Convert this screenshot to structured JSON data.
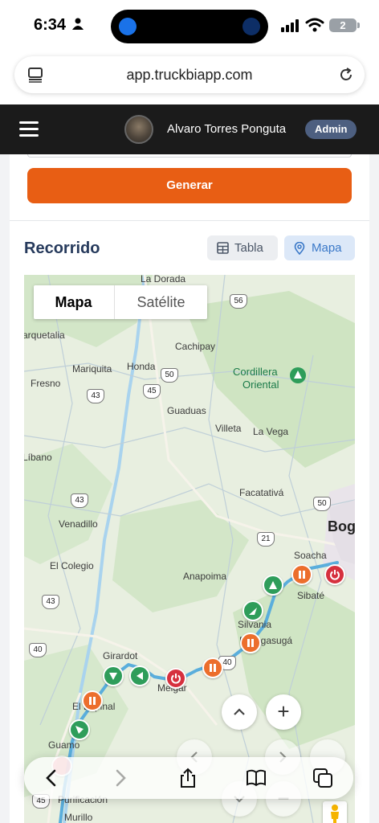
{
  "status_bar": {
    "time": "6:34",
    "battery": "2"
  },
  "browser": {
    "url": "app.truckbiapp.com"
  },
  "header": {
    "user_name": "Alvaro Torres Ponguta",
    "role": "Admin"
  },
  "actions": {
    "generate_label": "Generar"
  },
  "section": {
    "title": "Recorrido",
    "table_button": "Tabla",
    "map_button": "Mapa",
    "selected_view": "Mapa"
  },
  "map": {
    "type_map": "Mapa",
    "type_satellite": "Satélite",
    "zoom_in": "+",
    "zoom_out": "−",
    "labels": {
      "la_dorada": "La Dorada",
      "marquetalia": "arquetalia",
      "cachipay": "Cachipay",
      "mariquita": "Mariquita",
      "honda": "Honda",
      "fresno": "Fresno",
      "cordillera": "Cordillera",
      "oriental": "Oriental",
      "guaduas": "Guaduas",
      "villeta": "Villeta",
      "la_vega": "La Vega",
      "libano": "Líbano",
      "facatativa": "Facatativá",
      "venadillo": "Venadillo",
      "bogota": "Bog",
      "el_colegio": "El Colegio",
      "anapoima": "Anapoima",
      "soacha": "Soacha",
      "sibate": "Sibaté",
      "silvania": "Silvania",
      "fusagasuga": "Fusagasugá",
      "girardot": "Girardot",
      "melgar": "Melgar",
      "el_espinal": "El Espinal",
      "guamo": "Guamo",
      "purificacion": "Purificación",
      "murillo": "Murillo"
    },
    "road_shields": {
      "r56": "56",
      "r50a": "50",
      "r45a": "45",
      "r43a": "43",
      "r43b": "43",
      "r50b": "50",
      "r21": "21",
      "r43c": "43",
      "r40a": "40",
      "r40b": "40",
      "r45b": "45"
    },
    "route_color": "#5aaedc"
  },
  "colors": {
    "generate": "#e85e14",
    "header_bg": "#1b1b1b",
    "title": "#263a5c",
    "marker_stop": "#ec6e2c",
    "marker_moving": "#2e9d5a",
    "marker_off": "#d6303e"
  }
}
